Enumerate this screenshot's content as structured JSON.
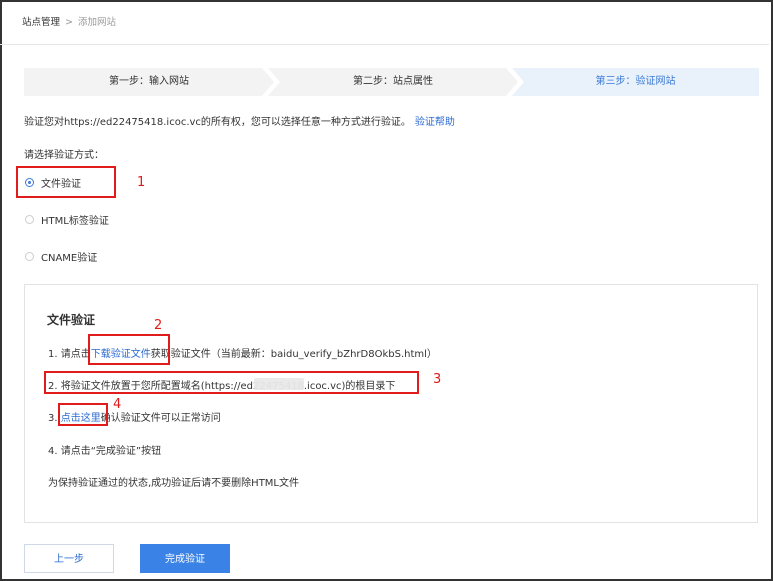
{
  "breadcrumb": {
    "root": "站点管理",
    "separator": ">",
    "current": "添加网站"
  },
  "steps": {
    "step1": "第一步：输入网站",
    "step2": "第二步：站点属性",
    "step3": "第三步：验证网站"
  },
  "intro": {
    "text": "验证您对https://ed22475418.icoc.vc的所有权，您可以选择任意一种方式进行验证。",
    "help_link": "验证帮助"
  },
  "choose_label": "请选择验证方式：",
  "methods": [
    {
      "label": "文件验证",
      "selected": true
    },
    {
      "label": "HTML标签验证",
      "selected": false
    },
    {
      "label": "CNAME验证",
      "selected": false
    }
  ],
  "panel": {
    "title": "文件验证",
    "line1": {
      "prefix": "1.  请点击",
      "link": "下载验证文件",
      "suffix": "获取验证文件（当前最新：baidu_verify_bZhrD8OkbS.html）"
    },
    "line2": "2.  将验证文件放置于您所配置域名(https://ed22475418.icoc.vc)的根目录下",
    "line3": {
      "prefix": "3.  ",
      "link": "点击这里",
      "suffix": "确认验证文件可以正常访问"
    },
    "line4": "4.  请点击“完成验证”按钮",
    "note": "为保持验证通过的状态,成功验证后请不要删除HTML文件"
  },
  "annotations": {
    "n1": "1",
    "n2": "2",
    "n3": "3",
    "n4": "4"
  },
  "buttons": {
    "prev": "上一步",
    "done": "完成验证"
  },
  "colors": {
    "accent": "#3a82e6",
    "link": "#2a6ad2",
    "annotation": "#e01b1b"
  }
}
